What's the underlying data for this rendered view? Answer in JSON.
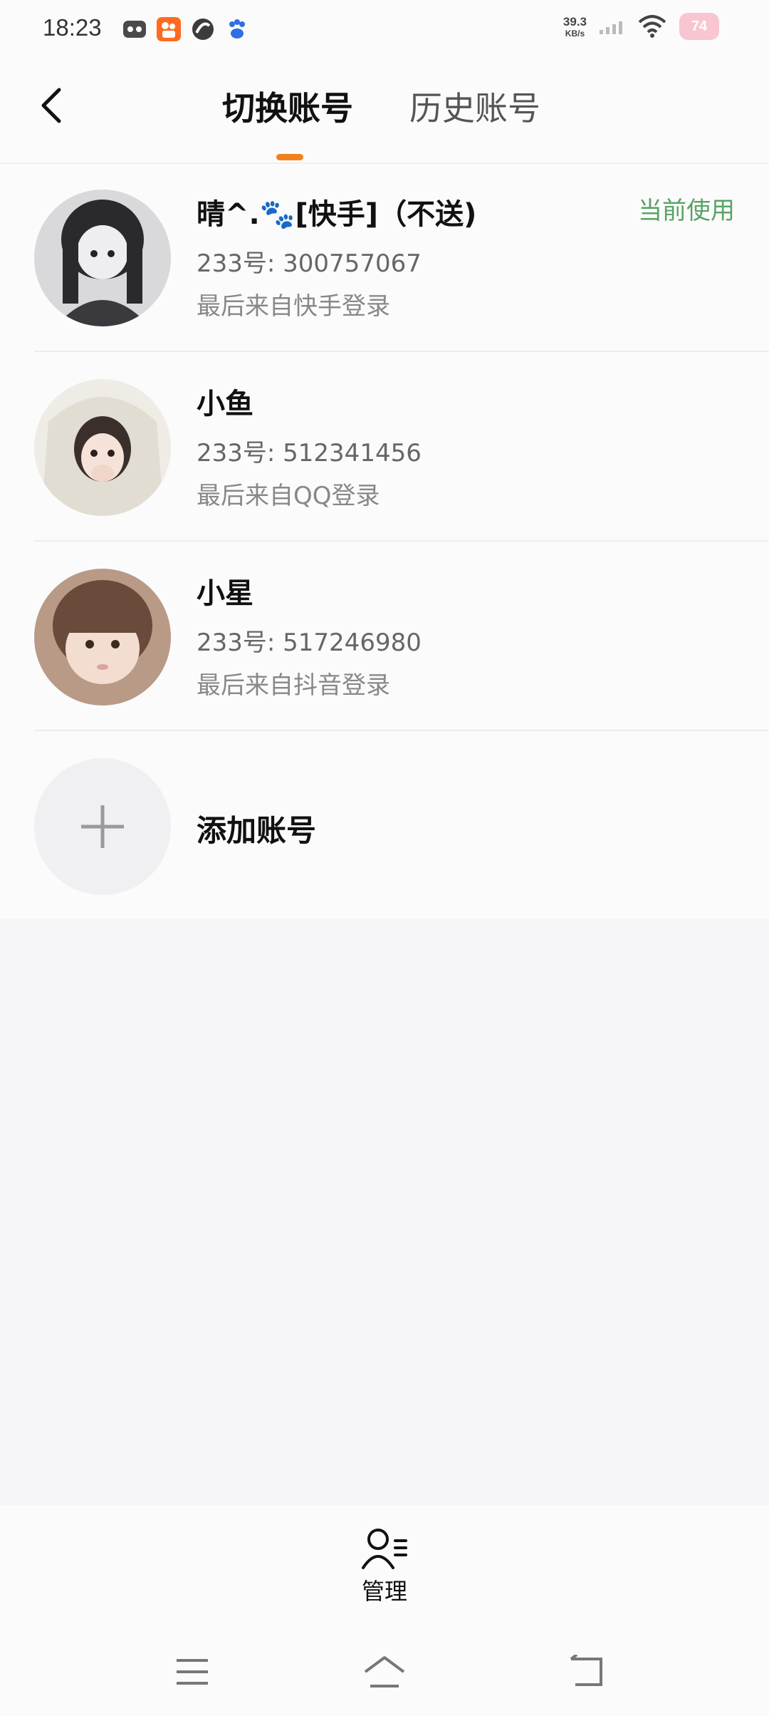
{
  "status_bar": {
    "time": "18:23",
    "net_speed_value": "39.3",
    "net_speed_unit": "KB/s",
    "battery": "74",
    "app_icons": [
      "gamepad-icon",
      "kuaishou-icon",
      "swirl-app-icon",
      "baidu-paw-icon"
    ],
    "status_icons": [
      "signal-icon",
      "wifi-icon",
      "battery-icon"
    ]
  },
  "header": {
    "tabs": [
      {
        "label": "切换账号",
        "active": true
      },
      {
        "label": "历史账号",
        "active": false
      }
    ],
    "accent_color": "#f2811d"
  },
  "accounts": [
    {
      "name": "晴^.🐾[快手]（不送)",
      "id_text": "233号: 300757067",
      "source_text": "最后来自快手登录",
      "badge": "当前使用"
    },
    {
      "name": "小鱼",
      "id_text": "233号: 512341456",
      "source_text": "最后来自QQ登录"
    },
    {
      "name": "小星",
      "id_text": "233号: 517246980",
      "source_text": "最后来自抖音登录"
    }
  ],
  "add_account": {
    "label": "添加账号"
  },
  "manage": {
    "label": "管理"
  },
  "colors": {
    "badge_green": "#5aa266",
    "background": "#f5f4f6",
    "surface": "#fbfbfb"
  }
}
